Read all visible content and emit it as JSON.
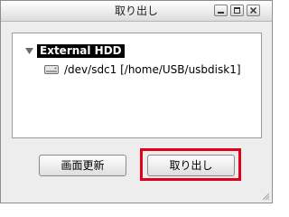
{
  "window": {
    "title": "取り出し"
  },
  "tree": {
    "root_label": "External HDD",
    "child_label": "/dev/sdc1 [/home/USB/usbdisk1]",
    "root_icon": "triangle-down-icon",
    "child_icon": "drive-icon"
  },
  "buttons": {
    "refresh_label": "画面更新",
    "eject_label": "取り出し"
  },
  "colors": {
    "highlight": "#e0001a",
    "selection": "#000000"
  }
}
